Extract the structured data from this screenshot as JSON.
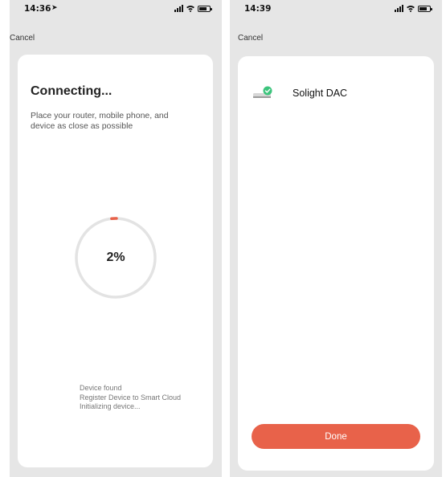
{
  "left_screen": {
    "status_bar": {
      "time": "14:36"
    },
    "cancel_label": "Cancel",
    "title": "Connecting...",
    "description": "Place your router, mobile phone, and device as close as possible",
    "progress": {
      "percent_label": "2%",
      "value": 0.02
    },
    "steps": [
      "Device found",
      "Register Device to Smart Cloud",
      "Initializing device..."
    ]
  },
  "right_screen": {
    "status_bar": {
      "time": "14:39"
    },
    "cancel_label": "Cancel",
    "device": {
      "name": "Solight DAC",
      "icon": "device-connected-icon"
    },
    "done_label": "Done"
  },
  "colors": {
    "accent": "#e8624a",
    "success": "#3cc47c",
    "ring_track": "#e3e3e3",
    "background": "#e6e6e6"
  }
}
